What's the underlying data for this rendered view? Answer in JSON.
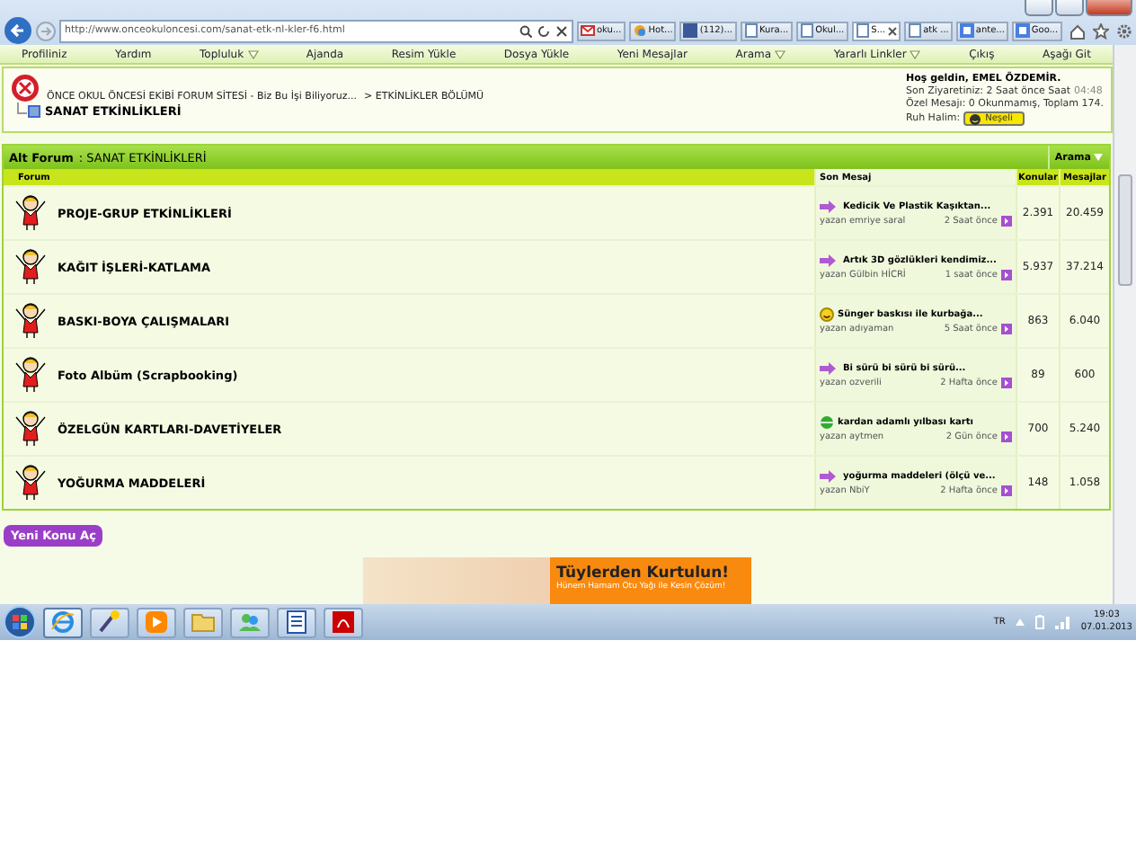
{
  "browser": {
    "address": "http://www.onceokuloncesi.com/sanat-etk-nl-kler-f6.html",
    "tabs": [
      {
        "label": "oku...",
        "selected": false,
        "kind": "mail"
      },
      {
        "label": "Hot...",
        "selected": false,
        "kind": "msn"
      },
      {
        "label": "(112)...",
        "selected": false,
        "kind": "facebook"
      },
      {
        "label": "Kura...",
        "selected": false,
        "kind": "page"
      },
      {
        "label": "Okul...",
        "selected": false,
        "kind": "page"
      },
      {
        "label": "S...",
        "selected": true,
        "kind": "page"
      },
      {
        "label": "atk ...",
        "selected": false,
        "kind": "page"
      },
      {
        "label": "ante...",
        "selected": false,
        "kind": "google"
      },
      {
        "label": "Goo...",
        "selected": false,
        "kind": "google"
      }
    ]
  },
  "nav": [
    {
      "label": "Profiliniz",
      "dropdown": false
    },
    {
      "label": "Yardım",
      "dropdown": false
    },
    {
      "label": "Topluluk",
      "dropdown": true
    },
    {
      "label": "Ajanda",
      "dropdown": false
    },
    {
      "label": "Resim Yükle",
      "dropdown": false
    },
    {
      "label": "Dosya Yükle",
      "dropdown": false
    },
    {
      "label": "Yeni Mesajlar",
      "dropdown": false
    },
    {
      "label": "Arama",
      "dropdown": true
    },
    {
      "label": "Yararlı Linkler",
      "dropdown": true
    },
    {
      "label": "Çıkış",
      "dropdown": false
    },
    {
      "label": "Aşağı Git",
      "dropdown": false
    }
  ],
  "header": {
    "breadcrumb": [
      "ÖNCE OKUL ÖNCESİ EKİBİ FORUM SİTESİ - Biz Bu İşi Biliyoruz...",
      "> ETKİNLİKLER BÖLÜMÜ"
    ],
    "title": "SANAT ETKİNLİKLERİ",
    "user": {
      "welcome": "Hoş geldin, EMEL ÖZDEMİR.",
      "last_visit": "Son Ziyaretiniz: 2 Saat önce Saat",
      "last_visit_time": "04:48",
      "messages": "Özel Mesajı: 0 Okunmamış, Toplam 174.",
      "mood_label": "Ruh Halim:",
      "mood": "Neşeli"
    }
  },
  "section": {
    "label": "Alt Forum",
    "name": ": SANAT ETKİNLİKLERİ",
    "search": "Arama"
  },
  "table": {
    "columns": [
      "Forum",
      "Son Mesaj",
      "Konular",
      "Mesajlar"
    ],
    "rows": [
      {
        "name": "PROJE-GRUP ETKİNLİKLERİ",
        "kind": "arrow",
        "last_title": "Kedicik Ve Plastik Kaşıktan...",
        "author": "yazan emriye saral",
        "time": "2 Saat önce",
        "topics": "2.391",
        "posts": "20.459"
      },
      {
        "name": "KAĞIT İŞLERİ-KATLAMA",
        "kind": "arrow",
        "last_title": "Artık 3D gözlükleri kendimiz...",
        "author": "yazan Gülbin HİCRİ",
        "time": "1 saat önce",
        "topics": "5.937",
        "posts": "37.214"
      },
      {
        "name": "BASKI-BOYA ÇALIŞMALARI",
        "kind": "smile",
        "last_title": "Sünger baskısı ile kurbağa...",
        "author": "yazan adıyaman",
        "time": "5 Saat önce",
        "topics": "863",
        "posts": "6.040"
      },
      {
        "name": "Foto Albüm (Scrapbooking)",
        "kind": "arrow",
        "last_title": "Bi sürü bi sürü bi sürü...",
        "author": "yazan ozverili",
        "time": "2 Hafta önce",
        "topics": "89",
        "posts": "600"
      },
      {
        "name": "ÖZELGÜN KARTLARI-DAVETİYELER",
        "kind": "green",
        "last_title": "kardan adamlı yılbası kartı",
        "author": "yazan aytmen",
        "time": "2 Gün önce",
        "topics": "700",
        "posts": "5.240"
      },
      {
        "name": "YOĞURMA MADDELERİ",
        "kind": "arrow",
        "last_title": "yoğurma maddeleri (ölçü ve...",
        "author": "yazan NbiY",
        "time": "2 Hafta önce",
        "topics": "148",
        "posts": "1.058"
      }
    ]
  },
  "new_topic": "Yeni Konu Aç",
  "ad": {
    "headline": "Tüylerden Kurtulun!",
    "text": "Hünem Hamam Otu Yağı ile Kesin Çözüm!"
  },
  "taskbar": {
    "language": "TR",
    "time": "19:03",
    "date": "07.01.2013",
    "apps": [
      {
        "kind": "ie",
        "selected": true
      },
      {
        "kind": "tool",
        "selected": false
      },
      {
        "kind": "media",
        "selected": false
      },
      {
        "kind": "folder",
        "selected": false
      },
      {
        "kind": "people",
        "selected": false
      },
      {
        "kind": "word",
        "selected": false
      },
      {
        "kind": "pdf",
        "selected": false
      }
    ]
  }
}
